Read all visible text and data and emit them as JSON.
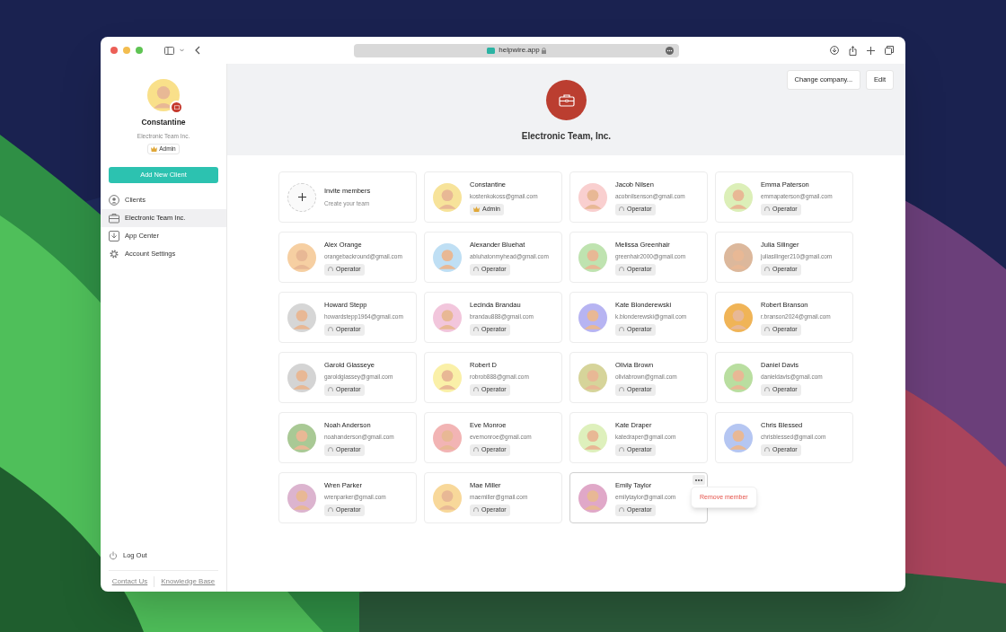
{
  "browser": {
    "url": "helpwire.app"
  },
  "profile": {
    "name": "Constantine",
    "company": "Electronic Team Inc.",
    "role": "Admin",
    "color": "#f9e08a"
  },
  "add_button": "Add New Client",
  "nav": [
    {
      "label": "Clients",
      "kind": "person",
      "selected": false
    },
    {
      "label": "Electronic Team Inc.",
      "kind": "company",
      "selected": true
    },
    {
      "label": "App Center",
      "kind": "apps",
      "selected": false
    },
    {
      "label": "Account Settings",
      "kind": "settings",
      "selected": false
    }
  ],
  "logout": "Log Out",
  "footer_links": [
    "Contact Us",
    "Knowledge Base"
  ],
  "header": {
    "company": "Electronic Team, Inc.",
    "buttons": [
      "Change company...",
      "Edit"
    ]
  },
  "invite": {
    "title": "Invite members",
    "subtitle": "Create your team"
  },
  "members": [
    {
      "name": "Constantine",
      "email": "kostenkokoss@gmail.com",
      "role": "Admin",
      "kind": "admin",
      "color": "#f7e39a"
    },
    {
      "name": "Jacob Nilsen",
      "email": "acobnilsenson@gmail.com",
      "role": "Operator",
      "kind": "operator",
      "color": "#f9cfcf"
    },
    {
      "name": "Emma Paterson",
      "email": "emmapaterson@gmail.com",
      "role": "Operator",
      "kind": "operator",
      "color": "#dcefb8"
    },
    {
      "name": "Alex Orange",
      "email": "orangebackround@gmail.com",
      "role": "Operator",
      "kind": "operator",
      "color": "#f6cfa2"
    },
    {
      "name": "Alexander Bluehat",
      "email": "abluhatonmyhead@gmail.com",
      "role": "Operator",
      "kind": "operator",
      "color": "#bfdff4"
    },
    {
      "name": "Melissa Greenhair",
      "email": "greenhair2000@gmail.com",
      "role": "Operator",
      "kind": "operator",
      "color": "#bfe3b0"
    },
    {
      "name": "Julia Silinger",
      "email": "juliasilinger210@gmail.com",
      "role": "Operator",
      "kind": "operator",
      "color": "#dcb89c"
    },
    {
      "name": "Howard Stepp",
      "email": "howardstepp1964@gmail.com",
      "role": "Operator",
      "kind": "operator",
      "color": "#d6d6d6"
    },
    {
      "name": "Lecinda Brandau",
      "email": "brandau888@gmail.com",
      "role": "Operator",
      "kind": "operator",
      "color": "#f2c6dc"
    },
    {
      "name": "Kate Blonderewski",
      "email": "k.blonderewski@gmail.com",
      "role": "Operator",
      "kind": "operator",
      "color": "#b7b4f2"
    },
    {
      "name": "Robert Branson",
      "email": "r.branson2024@gmail.com",
      "role": "Operator",
      "kind": "operator",
      "color": "#f0b457"
    },
    {
      "name": "Garold Glasseye",
      "email": "garoldglassey@gmail.com",
      "role": "Operator",
      "kind": "operator",
      "color": "#d4d4d4"
    },
    {
      "name": "Robert D",
      "email": "robrob888@gmail.com",
      "role": "Operator",
      "kind": "operator",
      "color": "#faf0a8"
    },
    {
      "name": "Olivia Brown",
      "email": "oliviabrown@gmail.com",
      "role": "Operator",
      "kind": "operator",
      "color": "#d6d49a"
    },
    {
      "name": "Daniel Davis",
      "email": "danieldavis@gmail.com",
      "role": "Operator",
      "kind": "operator",
      "color": "#b9dea0"
    },
    {
      "name": "Noah Anderson",
      "email": "noahanderson@gmail.com",
      "role": "Operator",
      "kind": "operator",
      "color": "#a9c995"
    },
    {
      "name": "Eve Monroe",
      "email": "evemonroe@gmail.com",
      "role": "Operator",
      "kind": "operator",
      "color": "#f2b4b4"
    },
    {
      "name": "Kate Draper",
      "email": "katedraper@gmail.com",
      "role": "Operator",
      "kind": "operator",
      "color": "#def0bc"
    },
    {
      "name": "Chris Blessed",
      "email": "chrisblessed@gmail.com",
      "role": "Operator",
      "kind": "operator",
      "color": "#b5c6f2"
    },
    {
      "name": "Wren Parker",
      "email": "wrenparker@gmail.com",
      "role": "Operator",
      "kind": "operator",
      "color": "#dcb4cf"
    },
    {
      "name": "Mae Miller",
      "email": "maemiller@gmail.com",
      "role": "Operator",
      "kind": "operator",
      "color": "#f8d89a"
    },
    {
      "name": "Emily Taylor",
      "email": "emilytaylor@gmail.com",
      "role": "Operator",
      "kind": "operator",
      "color": "#e0a8c8",
      "menu": [
        "Remove member"
      ]
    }
  ]
}
